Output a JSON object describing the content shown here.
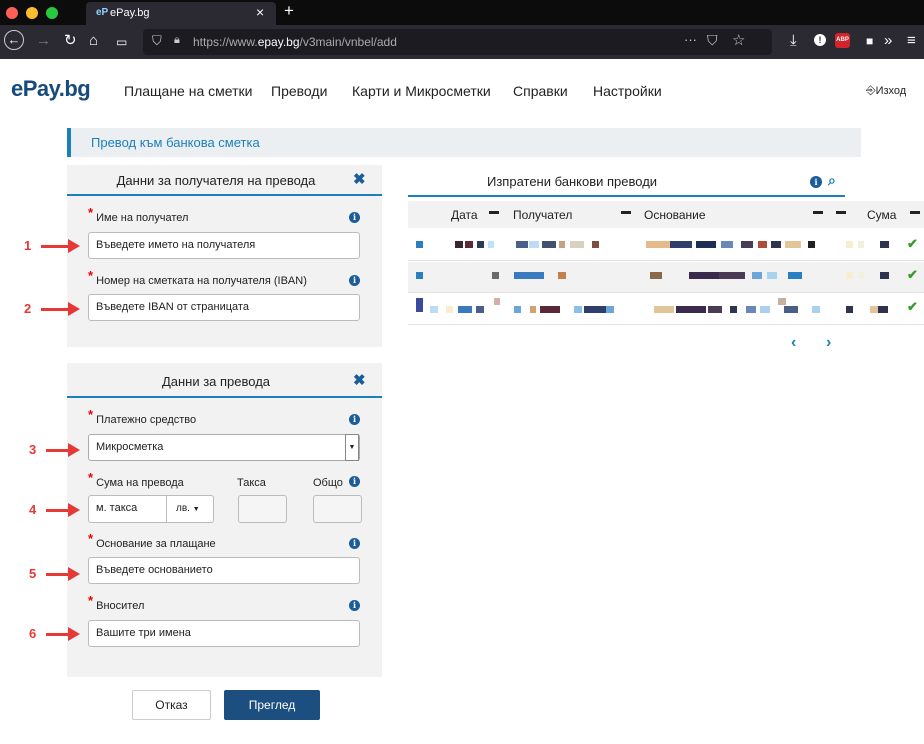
{
  "browser": {
    "tab_title": "ePay.bg",
    "tab_favicon": "eP",
    "url_host": "https://www.",
    "url_domain": "epay.bg",
    "url_path": "/v3main/vnbel/add"
  },
  "header": {
    "logo": "ePay.bg",
    "nav": [
      "Плащане на сметки",
      "Преводи",
      "Карти и Микросметки",
      "Справки",
      "Настройки"
    ],
    "exit": "Изход"
  },
  "page_title": "Превод към банкова сметка",
  "recipient_panel": {
    "title": "Данни за получателя на превода",
    "name_label": "Име на получател",
    "name_placeholder": "Въведете името на получателя",
    "iban_label": "Номер на сметката на получателя (IBAN)",
    "iban_placeholder": "Въведете IBAN от страницата"
  },
  "transfer_panel": {
    "title": "Данни за превода",
    "payment_label": "Платежно средство",
    "payment_value": "Микросметка",
    "amount_label": "Сума на превода",
    "fee_label": "Такса",
    "total_label": "Общо",
    "amount_placeholder": "м. такса",
    "currency": "лв.",
    "reason_label": "Основание за плащане",
    "reason_placeholder": "Въведете основанието",
    "depositor_label": "Вносител",
    "depositor_placeholder": "Вашите три имена"
  },
  "sent_panel": {
    "title": "Изпратени банкови преводи",
    "columns": [
      "Дата",
      "Получател",
      "Основание",
      "Сума"
    ]
  },
  "buttons": {
    "cancel": "Отказ",
    "review": "Преглед"
  },
  "annotations": [
    "1",
    "2",
    "3",
    "4",
    "5",
    "6"
  ],
  "colors": {
    "accent": "#1b7fba",
    "brand": "#164b7c",
    "annotation": "#e53935",
    "primary_button": "#1c4f80"
  }
}
